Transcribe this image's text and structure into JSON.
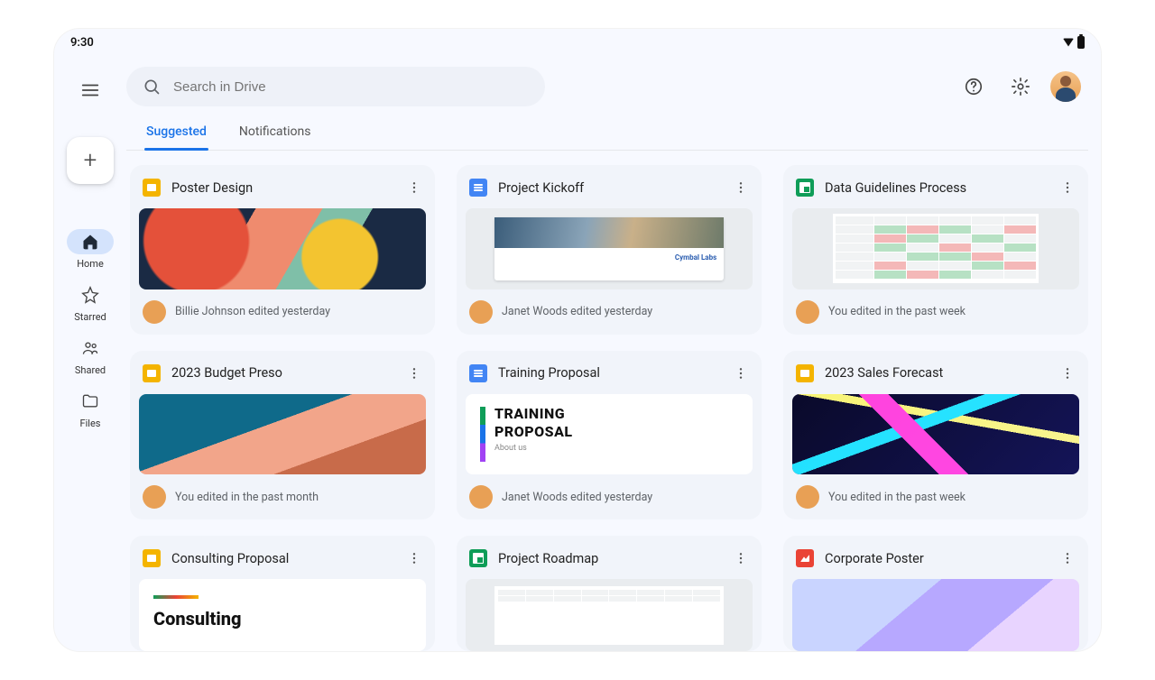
{
  "status": {
    "time": "9:30"
  },
  "search": {
    "placeholder": "Search in Drive"
  },
  "nav": {
    "home": "Home",
    "starred": "Starred",
    "shared": "Shared",
    "files": "Files"
  },
  "tabs": {
    "suggested": "Suggested",
    "notifications": "Notifications"
  },
  "cards": [
    {
      "title": "Poster Design",
      "meta": "Billie Johnson edited yesterday",
      "type": "slides"
    },
    {
      "title": "Project Kickoff",
      "meta": "Janet Woods edited yesterday",
      "type": "docs"
    },
    {
      "title": "Data Guidelines Process",
      "meta": "You edited in the past week",
      "type": "sheets"
    },
    {
      "title": "2023 Budget Preso",
      "meta": "You edited in the past month",
      "type": "slides"
    },
    {
      "title": "Training Proposal",
      "meta": "Janet Woods edited yesterday",
      "type": "docs"
    },
    {
      "title": "2023 Sales Forecast",
      "meta": "You edited in the past week",
      "type": "slides"
    },
    {
      "title": "Consulting Proposal",
      "meta": "",
      "type": "slides"
    },
    {
      "title": "Project Roadmap",
      "meta": "",
      "type": "sheets"
    },
    {
      "title": "Corporate Poster",
      "meta": "",
      "type": "image"
    }
  ],
  "thumbs": {
    "training_h1": "TRAINING",
    "training_h2": "PROPOSAL",
    "training_sub": "About us",
    "kickoff_logo": "Cymbal Labs",
    "consulting_h": "Consulting"
  }
}
